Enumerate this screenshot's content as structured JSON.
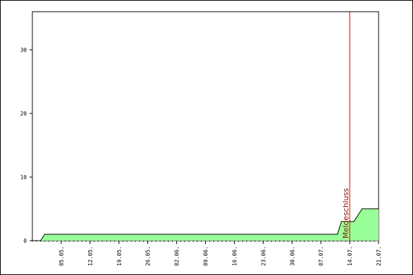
{
  "chart_data": {
    "type": "area",
    "title": "",
    "xlabel": "",
    "ylabel": "",
    "ylim": [
      0,
      36
    ],
    "y_ticks": [
      0,
      10,
      20,
      30
    ],
    "x_tick_labels": [
      "05.05.",
      "12.05.",
      "19.05.",
      "26.05.",
      "02.06.",
      "09.06.",
      "16.06.",
      "23.06.",
      "30.06.",
      "07.07.",
      "14.07.",
      "21.07."
    ],
    "date_range": [
      "2024-04-28",
      "2024-07-21"
    ],
    "series": [
      {
        "dates": [
          "2024-04-30",
          "2024-05-01",
          "2024-07-11",
          "2024-07-12",
          "2024-07-15",
          "2024-07-17",
          "2024-07-21"
        ],
        "values": [
          0,
          1,
          1,
          3,
          3,
          5,
          5
        ]
      }
    ],
    "annotation": {
      "label": "Meldeschluss",
      "date": "2024-07-14"
    },
    "colors": {
      "fill": "#99ff99",
      "stroke": "#000000",
      "annotation": "#cc0000",
      "annotation_text": "#7a1a00",
      "frame": "#000000"
    },
    "grid": false,
    "legend": "none"
  }
}
